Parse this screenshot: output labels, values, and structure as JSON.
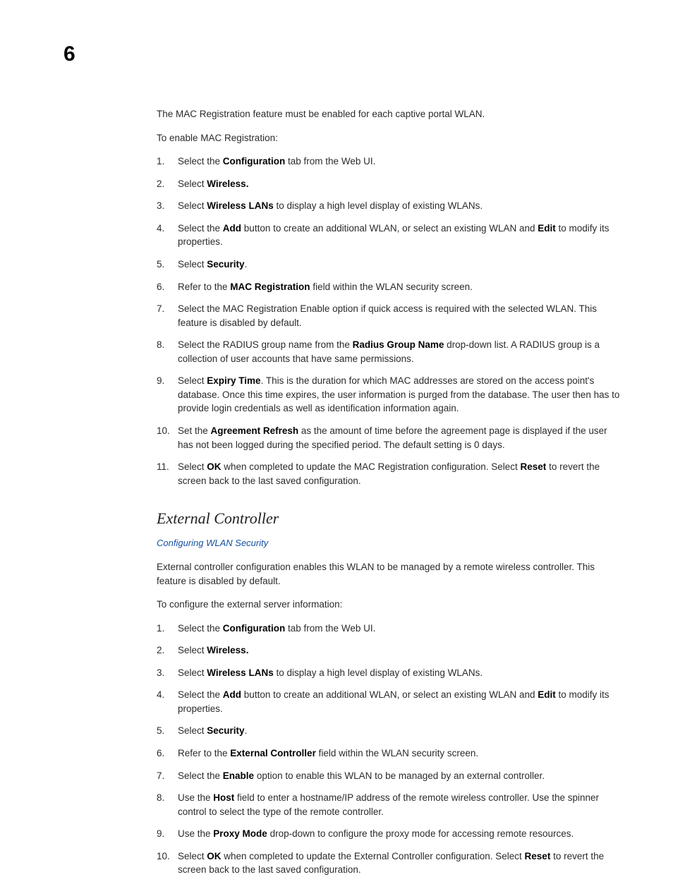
{
  "chapter_number": "6",
  "intro_para": "The MAC Registration feature must be enabled for each captive portal WLAN.",
  "lead_in_1": "To enable MAC Registration:",
  "steps1": {
    "s1": {
      "a": "Select the ",
      "b": "Configuration",
      "c": " tab from the Web UI."
    },
    "s2": {
      "a": "Select ",
      "b": "Wireless."
    },
    "s3": {
      "a": "Select ",
      "b": "Wireless LANs",
      "c": " to display a high level display of existing WLANs."
    },
    "s4": {
      "a": "Select the ",
      "b": "Add",
      "c": " button to create an additional WLAN, or select an existing WLAN and ",
      "d": "Edit",
      "e": " to modify its properties."
    },
    "s5": {
      "a": "Select ",
      "b": "Security",
      "c": "."
    },
    "s6": {
      "a": "Refer to the ",
      "b": "MAC Registration",
      "c": " field within the WLAN security screen."
    },
    "s7": "Select the MAC Registration Enable option if quick access is required with the selected WLAN. This feature is disabled by default.",
    "s8": {
      "a": "Select the RADIUS group name from the ",
      "b": "Radius Group Name",
      "c": " drop-down list. A RADIUS group is a collection of user accounts that have same permissions."
    },
    "s9": {
      "a": "Select ",
      "b": "Expiry Time",
      "c": ". This is the duration for which MAC addresses are stored on the access point's database. Once this time expires, the user information is purged from the database. The user then has to provide login credentials as well as identification information again."
    },
    "s10": {
      "a": "Set the ",
      "b": "Agreement Refresh",
      "c": " as the amount of time before the agreement page is displayed if the user has not been logged during the specified period. The default setting is 0 days."
    },
    "s11": {
      "a": "Select ",
      "b": "OK",
      "c": " when completed to update the MAC Registration configuration. Select ",
      "d": "Reset",
      "e": " to revert the screen back to the last saved configuration."
    }
  },
  "section2_title": "External Controller",
  "section2_crossref": "Configuring WLAN Security",
  "section2_para": "External controller configuration enables this WLAN to be managed by a remote wireless controller. This feature is disabled by default.",
  "lead_in_2": "To configure the external server information:",
  "steps2": {
    "s1": {
      "a": "Select the ",
      "b": "Configuration",
      "c": " tab from the Web UI."
    },
    "s2": {
      "a": "Select ",
      "b": "Wireless."
    },
    "s3": {
      "a": "Select ",
      "b": "Wireless LANs",
      "c": " to display a high level display of existing WLANs."
    },
    "s4": {
      "a": "Select the ",
      "b": "Add",
      "c": " button to create an additional WLAN, or select an existing WLAN and ",
      "d": "Edit",
      "e": " to modify its properties."
    },
    "s5": {
      "a": "Select ",
      "b": "Security",
      "c": "."
    },
    "s6": {
      "a": "Refer to the ",
      "b": "External Controller",
      "c": " field within the WLAN security screen."
    },
    "s7": {
      "a": "Select the ",
      "b": "Enable",
      "c": " option to enable this WLAN to be managed by an external controller."
    },
    "s8": {
      "a": "Use the ",
      "b": "Host",
      "c": " field to enter a hostname/IP address of the remote wireless controller. Use the spinner control to select the type of the remote controller."
    },
    "s9": {
      "a": "Use the ",
      "b": "Proxy Mode",
      "c": " drop-down to configure the proxy mode for accessing remote resources."
    },
    "s10": {
      "a": "Select ",
      "b": "OK",
      "c": " when completed to update the External Controller configuration. Select ",
      "d": "Reset",
      "e": " to revert the screen back to the last saved configuration."
    }
  }
}
